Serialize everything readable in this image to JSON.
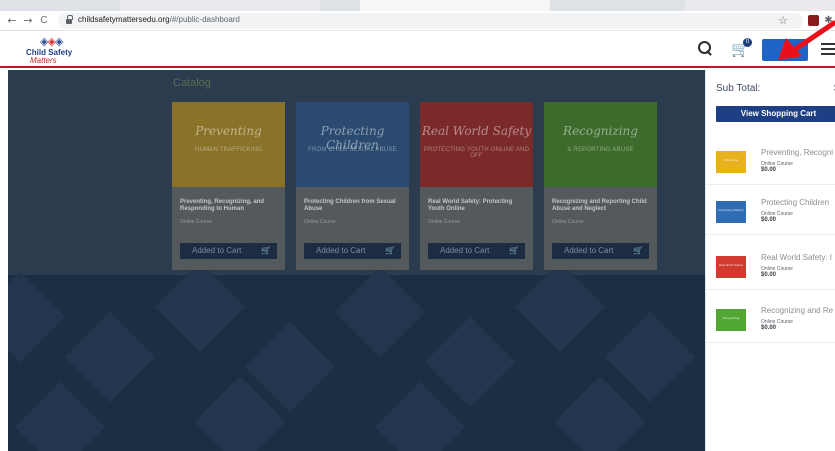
{
  "browser": {
    "url_host": "childsafetymattersedu.org",
    "url_path": "/#/public-dashboard",
    "back_glyph": "←",
    "forward_glyph": "→",
    "reload_glyph": "C",
    "bookmark_glyph": "☆"
  },
  "header": {
    "logo_line1": "Child Safety",
    "logo_line2": "Matters",
    "cart_count": "0",
    "search_icon": "search-icon",
    "cart_icon": "cart-icon",
    "menu_icon": "hamburger-menu-icon"
  },
  "catalog": {
    "title": "Catalog",
    "courses": [
      {
        "thumb_title": "Preventing",
        "thumb_subtitle": "HUMAN TRAFFICKING",
        "title": "Preventing, Recognizing, and Responding to Human",
        "type": "Online Course",
        "button": "Added to Cart",
        "color": "#d6a824"
      },
      {
        "thumb_title": "Protecting Children",
        "thumb_subtitle": "FROM CHILD SEXUAL ABUSE",
        "title": "Protecting Children from Sexual Abuse",
        "type": "Online Course",
        "button": "Added to Cart",
        "color": "#2f6fb0"
      },
      {
        "thumb_title": "Real World Safety",
        "thumb_subtitle": "PROTECTING YOUTH ONLINE AND OFF",
        "title": "Real World Safety: Protecting Youth Online",
        "type": "Online Course",
        "button": "Added to Cart",
        "color": "#c7332b"
      },
      {
        "thumb_title": "Recognizing",
        "thumb_subtitle": "& REPORTING ABUSE",
        "title": "Recognizing and Reporting Child Abuse and Neglect",
        "type": "Online Course",
        "button": "Added to Cart",
        "color": "#4e9a33"
      }
    ]
  },
  "cart_panel": {
    "subtotal_label": "Sub Total:",
    "subtotal_value": "$",
    "view_cart_label": "View Shopping Cart",
    "items": [
      {
        "name": "Preventing, Recogni",
        "type": "Online Course",
        "price": "$0.00",
        "thumb_text": "Preventing",
        "color": "#e8b21e"
      },
      {
        "name": "Protecting Children",
        "type": "Online Course",
        "price": "$0.00",
        "thumb_text": "Protecting Children",
        "color": "#2e6db3"
      },
      {
        "name": "Real World Safety: I",
        "type": "Online Course",
        "price": "$0.00",
        "thumb_text": "Real World Safety",
        "color": "#d13a2f"
      },
      {
        "name": "Recognizing and Re",
        "type": "Online Course",
        "price": "$0.00",
        "thumb_text": "Recognizing",
        "color": "#52a634"
      }
    ]
  },
  "annotation": {
    "arrow_color": "#e8101a"
  },
  "colors": {
    "brand_navy": "#1f3f85",
    "header_rule": "#b51d2d",
    "overlay_bg": "#2b3c4f"
  }
}
